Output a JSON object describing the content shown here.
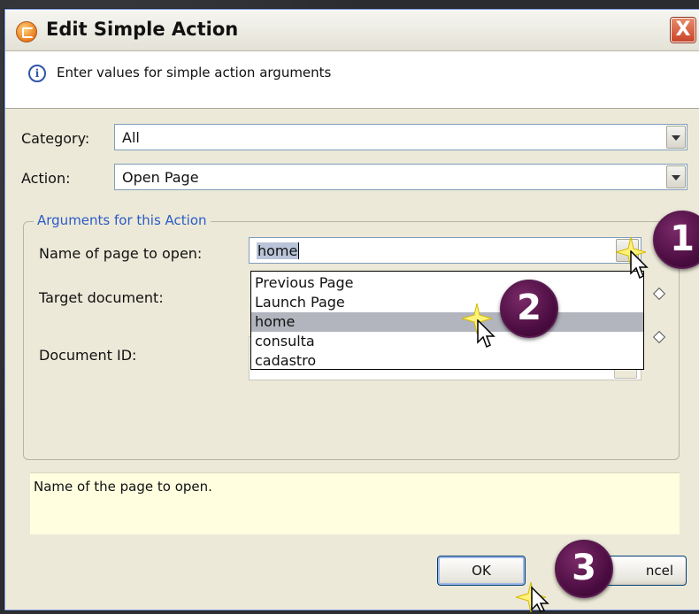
{
  "dialog": {
    "title": "Edit Simple Action",
    "close_label": "X",
    "info_text": "Enter values for simple action arguments"
  },
  "form": {
    "category_label": "Category:",
    "category_value": "All",
    "action_label": "Action:",
    "action_value": "Open Page"
  },
  "arguments": {
    "group_title": "Arguments for this Action",
    "page_label": "Name of page to open:",
    "page_value": "home",
    "target_label": "Target document:",
    "docid_label": "Document ID:"
  },
  "dropdown": {
    "options": [
      "Previous Page",
      "Launch Page",
      "home",
      "consulta",
      "cadastro"
    ],
    "highlighted": "home"
  },
  "help_text": "Name of the page to open.",
  "buttons": {
    "ok": "OK",
    "cancel_visible": "ncel"
  },
  "annotations": {
    "step1": "1",
    "step2": "2",
    "step3": "3"
  },
  "colors": {
    "badge": "#4a0c40",
    "group_title": "#2a5bc6",
    "help_bg": "#ffffe0",
    "highlight": "#b2b5bd"
  }
}
